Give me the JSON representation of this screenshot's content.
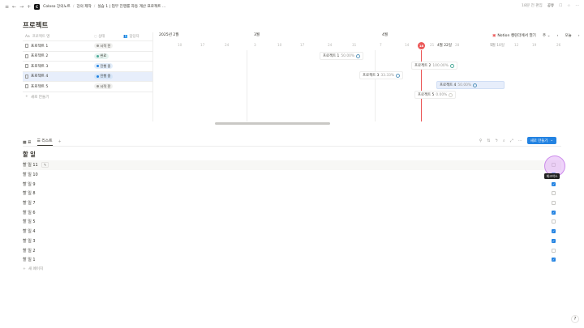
{
  "topbar": {
    "breadcrumbs": [
      "Coloso 강의노트",
      "강의 제작",
      "실습 1 | 업무 진행률 자동 계산 프로젝트 ..."
    ],
    "edited": "18분 전 편집",
    "share": "공유"
  },
  "page": {
    "title": "프로젝트"
  },
  "gantt": {
    "headers": {
      "name": "프로젝트 명",
      "status": "상태",
      "owner": "담당자"
    },
    "rows": [
      {
        "name": "프로젝트 1",
        "status": "시작 전",
        "status_color": "#9b9a97"
      },
      {
        "name": "프로젝트 2",
        "status": "완료",
        "status_color": "#4dab9a"
      },
      {
        "name": "프로젝트 3",
        "status": "진행 중",
        "status_color": "#2383e2"
      },
      {
        "name": "프로젝트 4",
        "status": "진행 중",
        "status_color": "#2383e2"
      },
      {
        "name": "프로젝트 5",
        "status": "시작 전",
        "status_color": "#9b9a97"
      }
    ],
    "new_row": "새로 만들기",
    "months": [
      "2025년 2월",
      "3월",
      "4월"
    ],
    "days": [
      "10",
      "17",
      "24",
      "3",
      "10",
      "17",
      "24",
      "31",
      "7",
      "14",
      "21",
      "28",
      "5",
      "12",
      "19",
      "26"
    ],
    "today": "18",
    "today_label": "4월 22일",
    "may_label": "5월 10일",
    "calendar_link": "Notion 캘린더에서 열기",
    "view_menu": "주",
    "today_btn": "오늘",
    "bars": [
      {
        "name": "프로젝트 1",
        "pct": "50.00%"
      },
      {
        "name": "프로젝트 2",
        "pct": "100.00%"
      },
      {
        "name": "프로젝트 3",
        "pct": "33.33%"
      },
      {
        "name": "프로젝트 4",
        "pct": "50.00%"
      },
      {
        "name": "프로젝트 5",
        "pct": "0.00%"
      }
    ]
  },
  "tasks": {
    "tabs": [
      "표",
      "리스트"
    ],
    "new_button": "새로 만들기",
    "title": "할 일",
    "edit_chip": "✎",
    "tooltip": "체크박스",
    "items": [
      {
        "name": "할 일 11",
        "done": false
      },
      {
        "name": "할 일 10",
        "done": true
      },
      {
        "name": "할 일 9",
        "done": true
      },
      {
        "name": "할 일 8",
        "done": false
      },
      {
        "name": "할 일 7",
        "done": false
      },
      {
        "name": "할 일 6",
        "done": true
      },
      {
        "name": "할 일 5",
        "done": false
      },
      {
        "name": "할 일 4",
        "done": true
      },
      {
        "name": "할 일 3",
        "done": true
      },
      {
        "name": "할 일 2",
        "done": false
      },
      {
        "name": "할 일 1",
        "done": true
      }
    ],
    "new_page": "새 페이지"
  },
  "help": "?"
}
